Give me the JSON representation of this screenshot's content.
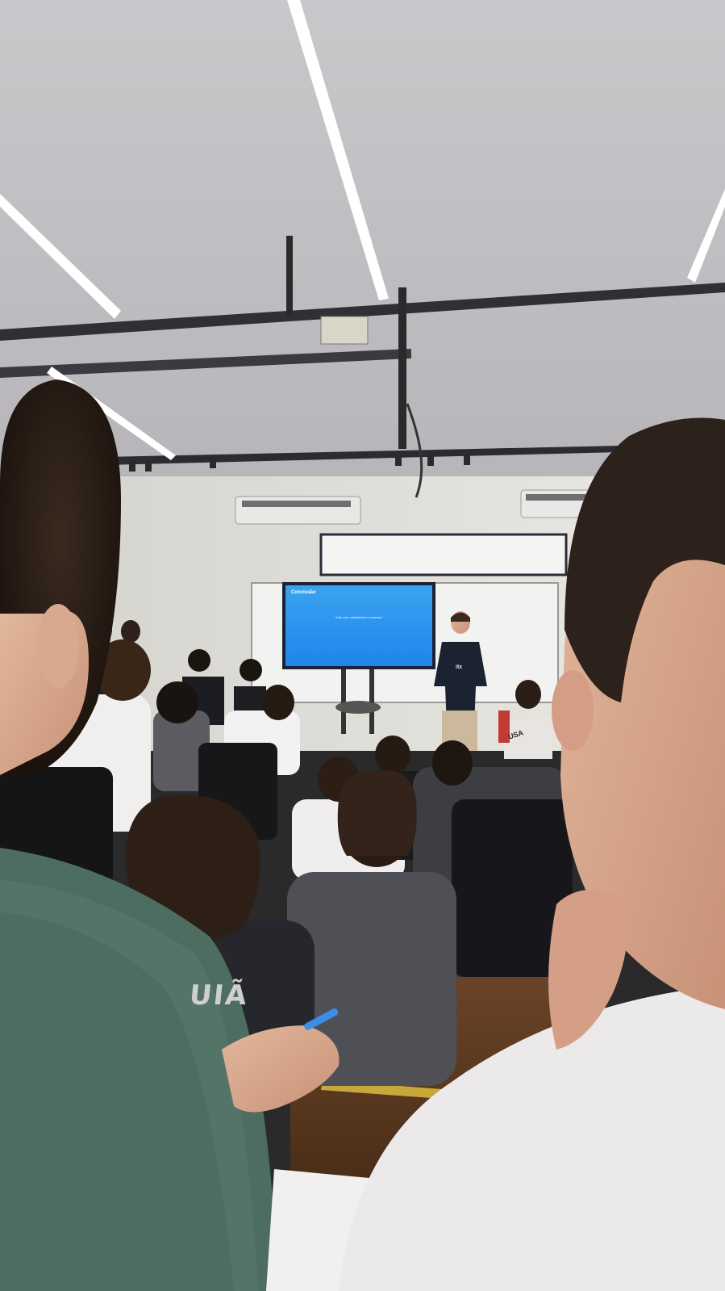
{
  "photo": {
    "subject": "",
    "palette": {
      "ceiling": "#bdbbbe",
      "wall": "#e6e4df",
      "screen": "#2b93ee",
      "floor": "#5a3a22",
      "green_sweater": "#4c6d60",
      "white_shirt": "#ece9ea"
    }
  },
  "slide": {
    "title": "Conclusão",
    "quote": "\"Uso com criatividade e sucesso\"",
    "bullets": [
      "",
      "",
      "",
      ""
    ],
    "footer": ""
  },
  "presenter": {
    "shirt_logo": "itx"
  },
  "audience": {
    "hoodie_print": "UIÃ",
    "right_shirt_print": "USA"
  }
}
